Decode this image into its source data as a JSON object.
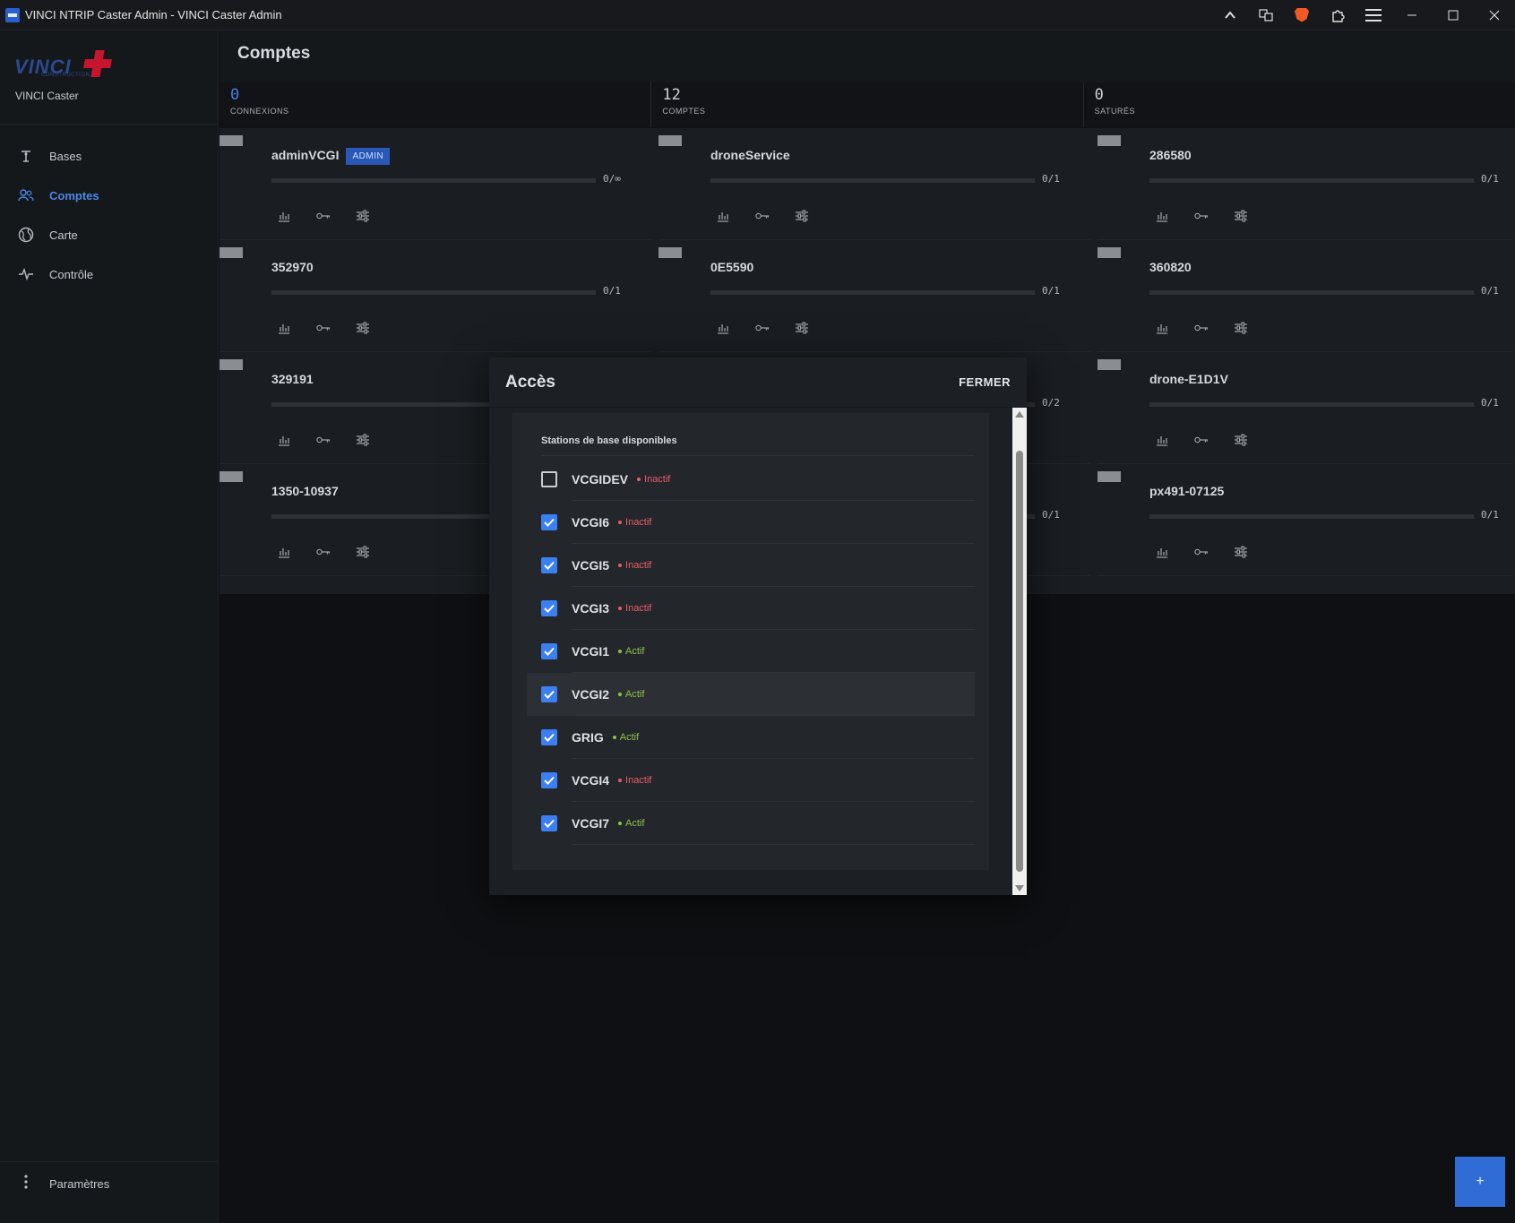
{
  "window": {
    "title": "VINCI NTRIP Caster Admin - VINCI Caster Admin"
  },
  "sidebar": {
    "logo_text": "VINCI",
    "logo_sub": "CONSTRUCTION",
    "brand": "VINCI Caster",
    "items": [
      {
        "label": "Bases",
        "icon": "antenna-icon"
      },
      {
        "label": "Comptes",
        "icon": "users-icon",
        "active": true
      },
      {
        "label": "Carte",
        "icon": "globe-icon"
      },
      {
        "label": "Contrôle",
        "icon": "activity-icon"
      }
    ],
    "settings_label": "Paramètres"
  },
  "header": {
    "title": "Comptes"
  },
  "stats": [
    {
      "value": "0",
      "label": "CONNEXIONS"
    },
    {
      "value": "12",
      "label": "COMPTES"
    },
    {
      "value": "0",
      "label": "SATURÉS"
    }
  ],
  "accounts": [
    {
      "name": "adminVCGI",
      "badge": "ADMIN",
      "quota": "0/∞",
      "usage": 0
    },
    {
      "name": "droneService",
      "quota": "0/1",
      "usage": 0
    },
    {
      "name": "286580",
      "quota": "0/1",
      "usage": 0
    },
    {
      "name": "352970",
      "quota": "0/1",
      "usage": 0
    },
    {
      "name": "0E5590",
      "quota": "0/1",
      "usage": 0
    },
    {
      "name": "360820",
      "quota": "0/1",
      "usage": 0
    },
    {
      "name": "329191",
      "quota": "",
      "usage": 0
    },
    {
      "name": "",
      "quota": "0/2",
      "usage": 0
    },
    {
      "name": "drone-E1D1V",
      "quota": "0/1",
      "usage": 0
    },
    {
      "name": "1350-10937",
      "quota": "",
      "usage": 0
    },
    {
      "name": "",
      "quota": "0/1",
      "usage": 0
    },
    {
      "name": "px491-07125",
      "quota": "0/1",
      "usage": 0
    }
  ],
  "modal": {
    "title": "Accès",
    "close_label": "FERMER",
    "list_title": "Stations de base disponibles",
    "stations": [
      {
        "name": "VCGIDEV",
        "status": "Inactif",
        "checked": false
      },
      {
        "name": "VCGI6",
        "status": "Inactif",
        "checked": true
      },
      {
        "name": "VCGI5",
        "status": "Inactif",
        "checked": true
      },
      {
        "name": "VCGI3",
        "status": "Inactif",
        "checked": true
      },
      {
        "name": "VCGI1",
        "status": "Actif",
        "checked": true
      },
      {
        "name": "VCGI2",
        "status": "Actif",
        "checked": true
      },
      {
        "name": "GRIG",
        "status": "Actif",
        "checked": true
      },
      {
        "name": "VCGI4",
        "status": "Inactif",
        "checked": true
      },
      {
        "name": "VCGI7",
        "status": "Actif",
        "checked": true
      }
    ]
  },
  "fab_label": "+",
  "colors": {
    "accent": "#3b7ff0",
    "inactive": "#e85c68",
    "active": "#8fc24a"
  }
}
